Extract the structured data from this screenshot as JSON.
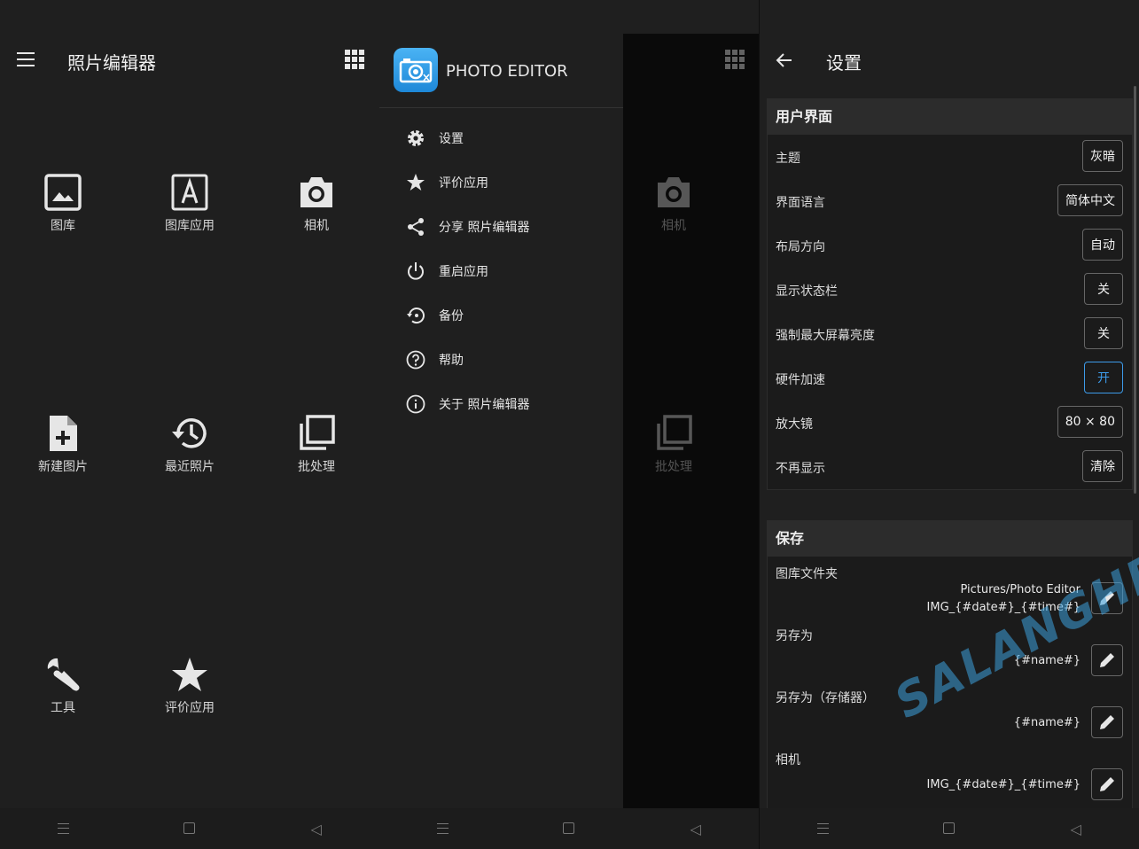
{
  "home": {
    "title": "照片编辑器",
    "tiles": [
      {
        "icon": "gallery-icon",
        "label": "图库"
      },
      {
        "icon": "gallery-app-icon",
        "label": "图库应用"
      },
      {
        "icon": "camera-icon",
        "label": "相机"
      },
      {
        "icon": "new-image-icon",
        "label": "新建图片"
      },
      {
        "icon": "history-icon",
        "label": "最近照片"
      },
      {
        "icon": "batch-icon",
        "label": "批处理"
      },
      {
        "icon": "wrench-icon",
        "label": "工具"
      },
      {
        "icon": "star-icon",
        "label": "评价应用"
      }
    ]
  },
  "drawer": {
    "app_name": "PHOTO EDITOR",
    "items": [
      {
        "icon": "gear-icon",
        "label": "设置"
      },
      {
        "icon": "star-icon",
        "label": "评价应用"
      },
      {
        "icon": "share-icon",
        "label": "分享 照片编辑器"
      },
      {
        "icon": "power-icon",
        "label": "重启应用"
      },
      {
        "icon": "backup-icon",
        "label": "备份"
      },
      {
        "icon": "help-icon",
        "label": "帮助"
      },
      {
        "icon": "info-icon",
        "label": "关于 照片编辑器"
      }
    ],
    "background_tiles": [
      "相机",
      "批处理"
    ]
  },
  "settings": {
    "title": "设置",
    "ui_section": {
      "header": "用户界面",
      "rows": [
        {
          "label": "主题",
          "value": "灰暗"
        },
        {
          "label": "界面语言",
          "value": "简体中文"
        },
        {
          "label": "布局方向",
          "value": "自动"
        },
        {
          "label": "显示状态栏",
          "value": "关"
        },
        {
          "label": "强制最大屏幕亮度",
          "value": "关"
        },
        {
          "label": "硬件加速",
          "value": "开"
        },
        {
          "label": "放大镜",
          "value": "80 × 80"
        },
        {
          "label": "不再显示",
          "value": "清除"
        }
      ]
    },
    "save_section": {
      "header": "保存",
      "rows": [
        {
          "label": "图库文件夹",
          "value_line1": "Pictures/Photo Editor",
          "value_line2": "IMG_{#date#}_{#time#}"
        },
        {
          "label": "另存为",
          "value_line1": "{#name#}"
        },
        {
          "label": "另存为（存储器）",
          "value_line1": "{#name#}"
        },
        {
          "label": "相机",
          "value_line1": "IMG_{#date#}_{#time#}"
        }
      ]
    }
  },
  "watermark": "SALANGHE",
  "colors": {
    "background": "#1f1f1f",
    "accent": "#3d9be9",
    "app_icon": "#2a9be8"
  }
}
